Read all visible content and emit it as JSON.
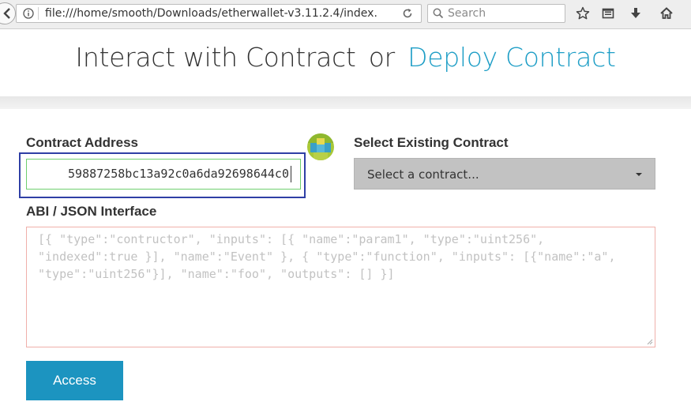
{
  "browser": {
    "url": "file:///home/smooth/Downloads/etherwallet-v3.11.2.4/index.",
    "search_placeholder": "Search"
  },
  "header": {
    "interact_label": "Interact with Contract",
    "or_label": "or",
    "deploy_label": "Deploy Contract"
  },
  "form": {
    "contract_address_label": "Contract Address",
    "contract_address_value": "59887258bc13a92c0a6da92698644c0",
    "select_label": "Select Existing Contract",
    "select_value": "Select a contract...",
    "abi_label": "ABI / JSON Interface",
    "abi_placeholder": "[{ \"type\":\"contructor\", \"inputs\": [{ \"name\":\"param1\", \"type\":\"uint256\", \"indexed\":true }], \"name\":\"Event\" }, { \"type\":\"function\", \"inputs\": [{\"name\":\"a\", \"type\":\"uint256\"}], \"name\":\"foo\", \"outputs\": [] }]",
    "access_button": "Access"
  },
  "colors": {
    "accent": "#1e9ec6",
    "button": "#1c94c0",
    "focus_outline": "#2f3fa5"
  }
}
